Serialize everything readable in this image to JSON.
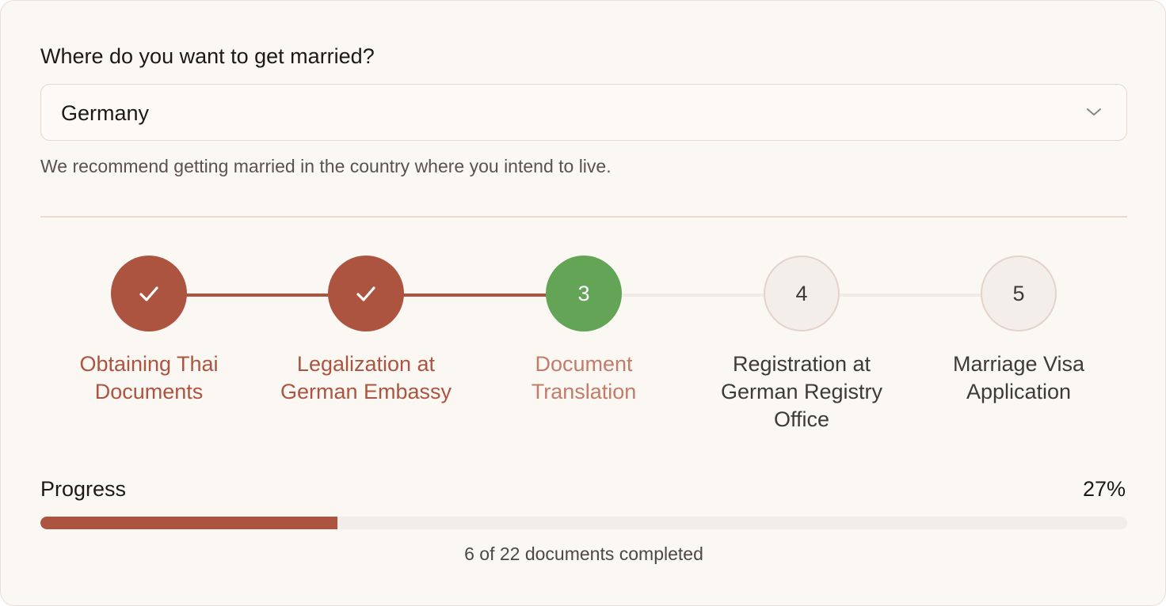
{
  "question": "Where do you want to get married?",
  "country_select": {
    "value": "Germany"
  },
  "hint": "We recommend getting married in the country where you intend to live.",
  "steps": [
    {
      "marker": "",
      "label": "Obtaining Thai Documents",
      "status": "done"
    },
    {
      "marker": "",
      "label": "Legalization at German Embassy",
      "status": "done"
    },
    {
      "marker": "3",
      "label": "Document Translation",
      "status": "current"
    },
    {
      "marker": "4",
      "label": "Registration at German Registry Office",
      "status": "pending"
    },
    {
      "marker": "5",
      "label": "Marriage Visa Application",
      "status": "pending"
    }
  ],
  "progress": {
    "label": "Progress",
    "percent_text": "27%",
    "fraction": 0.273,
    "summary": "6 of 22 documents completed"
  },
  "colors": {
    "accent": "#ad5440",
    "current": "#63a456",
    "pending_bg": "#f4eeeb",
    "background": "#fbf7f3"
  }
}
